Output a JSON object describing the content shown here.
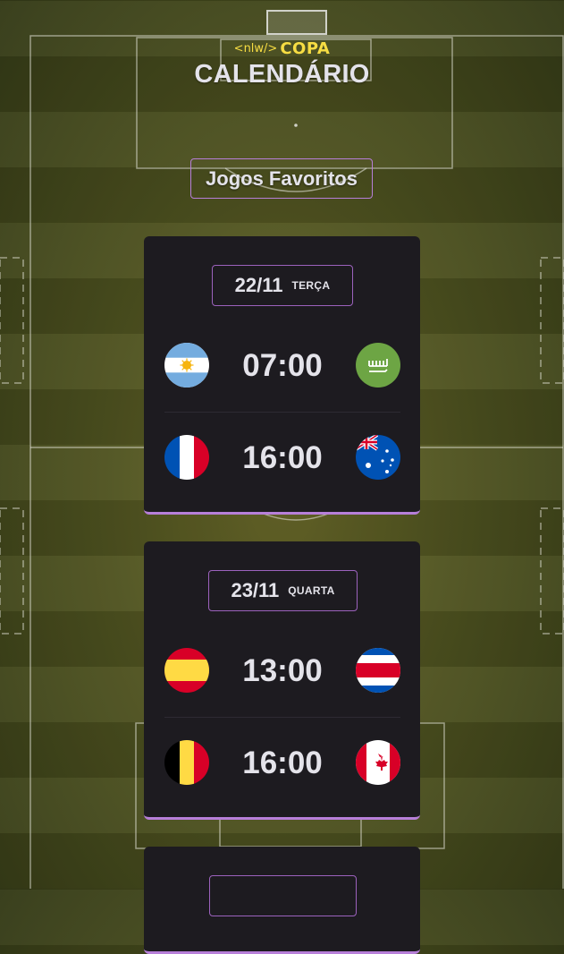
{
  "header": {
    "logo_prefix": "<nlw/>",
    "logo_name": "COPA",
    "title": "CALENDÁRIO"
  },
  "favorites_button": {
    "label": "Jogos Favoritos"
  },
  "cards": [
    {
      "date": "22/11",
      "weekday": "TERÇA",
      "matches": [
        {
          "home": "argentina-flag-icon",
          "time": "07:00",
          "away": "saudi-arabia-flag-icon"
        },
        {
          "home": "france-flag-icon",
          "time": "16:00",
          "away": "australia-flag-icon"
        }
      ]
    },
    {
      "date": "23/11",
      "weekday": "QUARTA",
      "matches": [
        {
          "home": "spain-flag-icon",
          "time": "13:00",
          "away": "costa-rica-flag-icon"
        },
        {
          "home": "belgium-flag-icon",
          "time": "16:00",
          "away": "canada-flag-icon"
        }
      ]
    }
  ],
  "colors": {
    "accent": "#b77fd9",
    "logo": "#f7dd43",
    "card_bg": "#1d1b20",
    "text": "#e4e3ea"
  }
}
